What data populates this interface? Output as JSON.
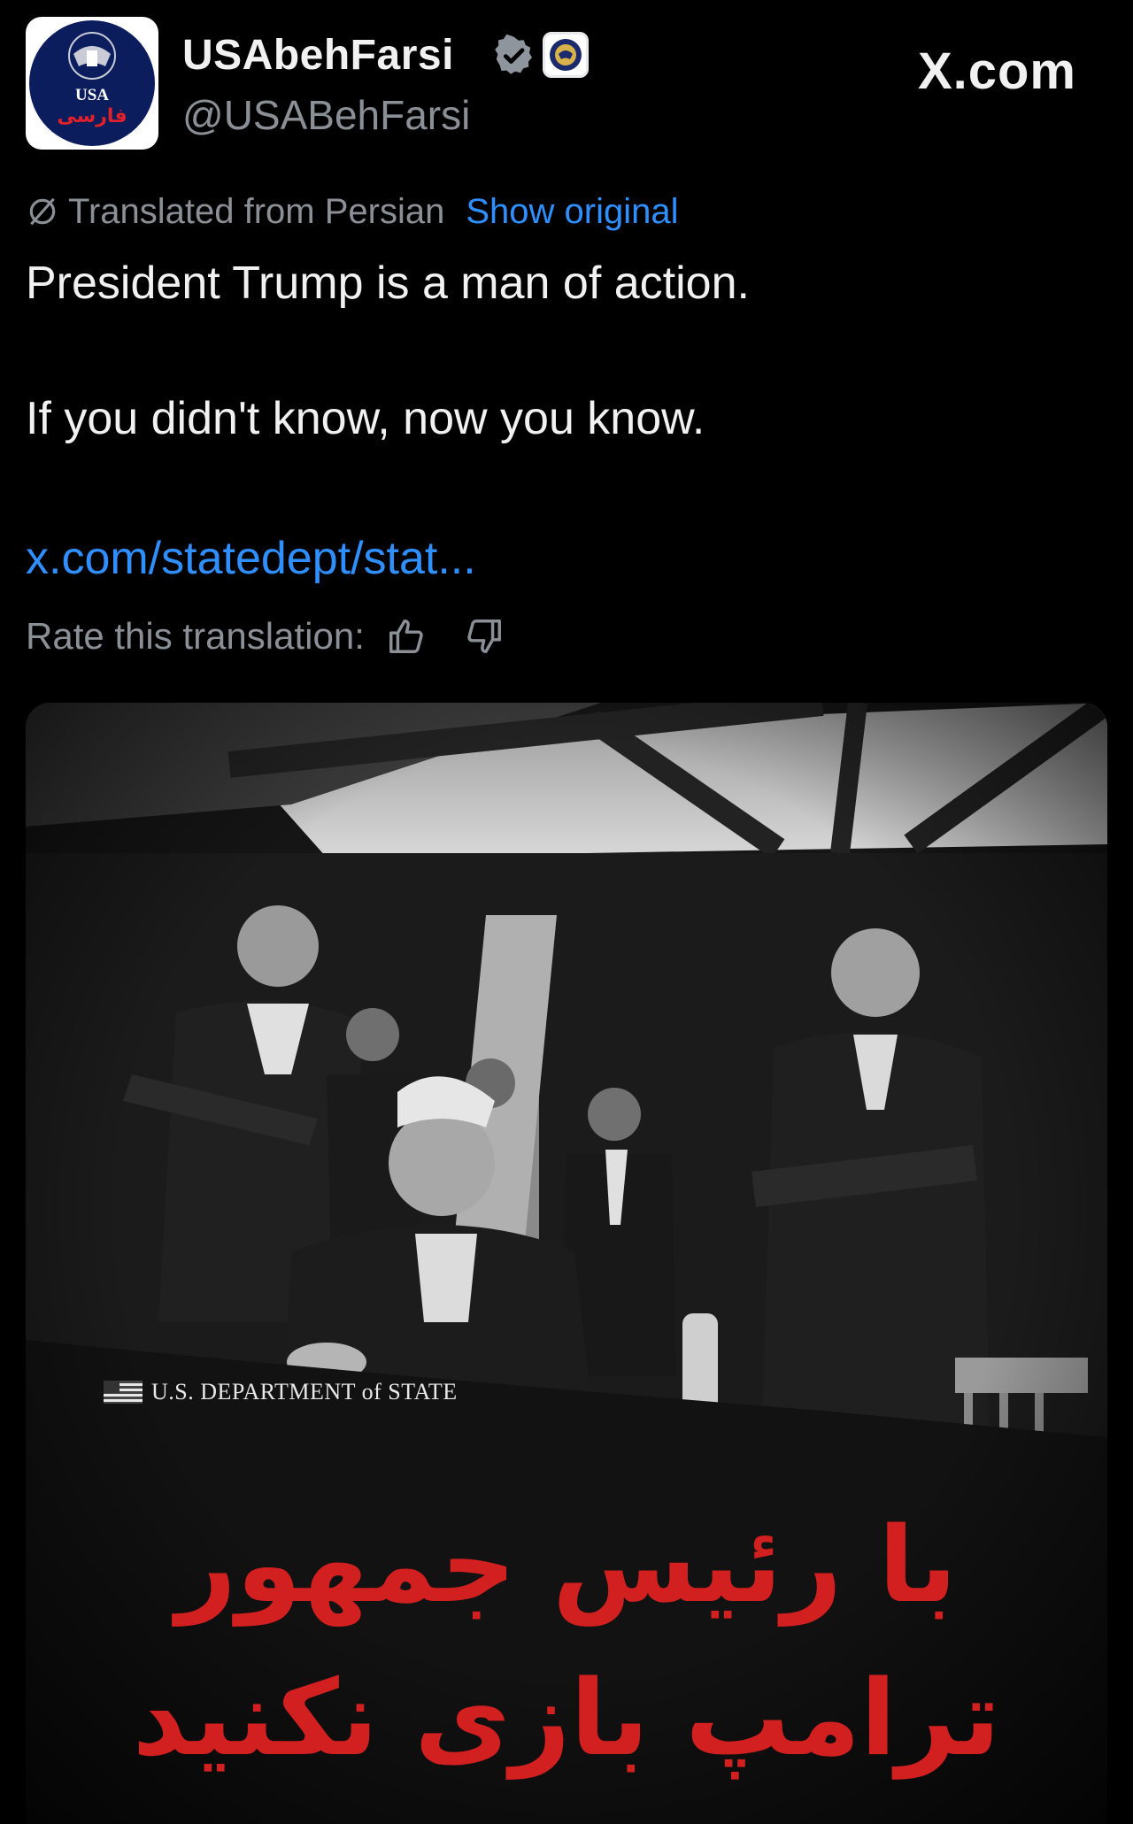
{
  "account": {
    "display_name": "USAbehFarsi",
    "handle": "@USABehFarsi",
    "avatar_text": "USA",
    "avatar_farsi": "فارسی"
  },
  "site_label": "X.com",
  "translation": {
    "label": "Translated from Persian",
    "show_original": "Show original"
  },
  "tweet": {
    "line1": "President Trump is a man of action.",
    "line2": "If you didn't know, now you know.",
    "link": "x.com/statedept/stat..."
  },
  "rate": {
    "label": "Rate this translation:"
  },
  "media": {
    "caption": "U.S. DEPARTMENT of STATE",
    "overlay_line1": "با رئیس جمهور",
    "overlay_line2": "ترامپ بازی نکنید"
  },
  "colors": {
    "background": "#000000",
    "link": "#2f8fff",
    "secondary_text": "#8b9096",
    "overlay_red": "#d21f1f"
  },
  "icons": [
    "verified-badge-icon",
    "government-seal-icon",
    "translate-slash-icon",
    "thumbs-up-icon",
    "thumbs-down-icon"
  ]
}
